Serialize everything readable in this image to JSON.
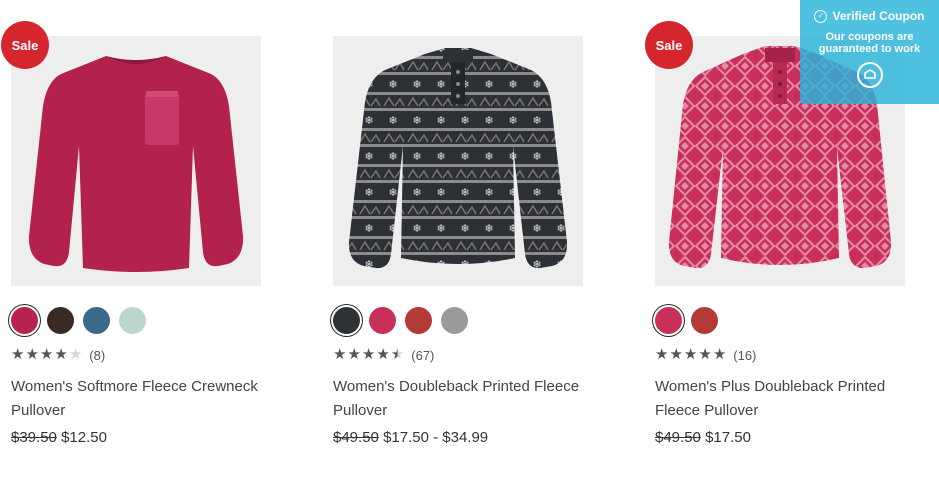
{
  "coupon": {
    "title": "Verified Coupon",
    "subtitle_line1": "Our coupons are",
    "subtitle_line2": "guaranteed to work",
    "icons": [
      "check-circle-icon",
      "coupon-logo-icon"
    ]
  },
  "products": [
    {
      "badge": "Sale",
      "swatch_colors": [
        "#b7224f",
        "#3a2a24",
        "#3a6a88",
        "#bcd6ce"
      ],
      "rating": 4,
      "review_count": "(8)",
      "title_line1": "Women's Softmore Fleece Crewneck",
      "title_line2": "Pullover",
      "price_old": "$39.50",
      "price_new": "$12.50"
    },
    {
      "badge": "",
      "swatch_colors": [
        "#2f3234",
        "#c8305a",
        "#b33a37",
        "#9a9a9a"
      ],
      "rating": 4.5,
      "review_count": "(67)",
      "title_line1": "Women's Doubleback Printed Fleece",
      "title_line2": "Pullover",
      "price_old": "$49.50",
      "price_new": "$17.50 - $34.99"
    },
    {
      "badge": "Sale",
      "swatch_colors": [
        "#c8305a",
        "#b33a37"
      ],
      "rating": 5,
      "review_count": "(16)",
      "title_line1": "Women's Plus Doubleback Printed",
      "title_line2": "Fleece Pullover",
      "price_old": "$49.50",
      "price_new": "$17.50"
    }
  ]
}
